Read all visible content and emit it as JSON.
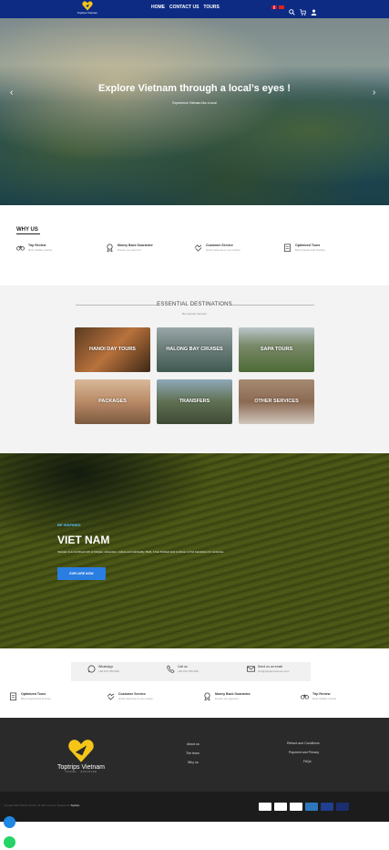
{
  "header": {
    "logo_text": "Toptrips Vietnam",
    "nav": [
      "HOME",
      "CONTACT US",
      "TOURS"
    ],
    "bg_color": "#0d2b83"
  },
  "hero": {
    "title": "Explore Vietnam through a local’s eyes !",
    "subtitle": "Experience Vietnam like a local"
  },
  "why_us": {
    "title": "WHY US",
    "items": [
      {
        "title": "Trip Review",
        "sub": "Most reliable reviews",
        "icon": "binoculars-icon"
      },
      {
        "title": "Money Back Guarantee",
        "sub": "Ensure you payment",
        "icon": "medal-icon"
      },
      {
        "title": "Customer Service",
        "sub": "Quick response to you enquiry",
        "icon": "handshake-icon"
      },
      {
        "title": "Optimized Tours",
        "sub": "Best programmed itinerary",
        "icon": "clipboard-icon"
      }
    ]
  },
  "destinations": {
    "title": "ESSENTIAL DESTINATIONS",
    "subtitle": "Be inspired Vietnam",
    "tiles": [
      "HANOI DAY TOURS",
      "HALONG BAY CRUISES",
      "SAPA TOURS",
      "PACKAGES",
      "TRANSFERS",
      "OTHER SERVICES"
    ]
  },
  "vietnam": {
    "eyebrow": "BE INSPIRED",
    "title": "VIET NAM",
    "description": "Vietnam is a combined rich of intrigue, adventure, culture and spirituality. Bold, it has finished and continue to find transitions for centuries.",
    "button": "EXPLORE NOW"
  },
  "contact": [
    {
      "label": "WhatsApp",
      "value": "+84.072.786.608",
      "icon": "whatsapp-icon"
    },
    {
      "label": "Call us",
      "value": "+84.072.786.608",
      "icon": "phone-icon"
    },
    {
      "label": "Send us an email",
      "value": "info@toptripsvietnam.com",
      "icon": "envelope-icon"
    }
  ],
  "features_row": [
    {
      "title": "Optimized Tours",
      "sub": "Best programmed itinerary",
      "icon": "clipboard-icon"
    },
    {
      "title": "Customer Service",
      "sub": "Quick response to you enquiry",
      "icon": "handshake-icon"
    },
    {
      "title": "Money Back Guarantee",
      "sub": "Ensure you payment",
      "icon": "medal-icon"
    },
    {
      "title": "Trip Review",
      "sub": "Most reliable reviews",
      "icon": "binoculars-icon"
    }
  ],
  "footer": {
    "brand": "Toptrips Vietnam",
    "tagline": "TRAVEL · DISCOVER",
    "col1": [
      "About us",
      "The team",
      "Why us"
    ],
    "col2": [
      "Refund and Conditions",
      "Payment and Privacy",
      "FAQs"
    ],
    "copyright_prefix": "Copyright 2020 Toptrips Vietnam. All rights reserved. Designed by",
    "copyright_brand": "Toptrips",
    "payments": [
      "VISA",
      "MasterCard",
      "PayPal",
      "American Express",
      "PM",
      "Maestro"
    ]
  }
}
